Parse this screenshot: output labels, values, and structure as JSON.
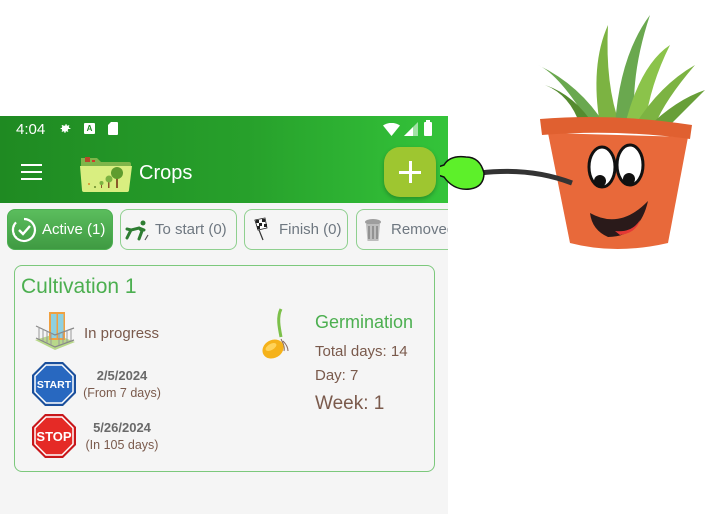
{
  "statusbar": {
    "time": "4:04",
    "icons": [
      "gear-icon",
      "a-notification-icon",
      "sd-card-icon",
      "wifi-icon",
      "signal-icon",
      "battery-icon"
    ]
  },
  "appbar": {
    "title": "Crops",
    "menu_icon": "hamburger-menu-icon",
    "logo_icon": "crops-folder-icon",
    "fab_icon": "plus-icon"
  },
  "colors": {
    "appbar_start": "#1f8a22",
    "appbar_end": "#34c43a",
    "fab": "#9ec630",
    "accent_green": "#4caf50",
    "text_brown": "#7a5a4c",
    "chip_border": "#8fd08f"
  },
  "filters": [
    {
      "label": "Active (1)",
      "icon": "check-circle-icon",
      "active": true
    },
    {
      "label": "To start (0)",
      "icon": "runner-start-icon",
      "active": false
    },
    {
      "label": "Finish (0)",
      "icon": "checkered-flag-icon",
      "active": false
    },
    {
      "label": "Removed",
      "icon": "trash-can-icon",
      "active": false
    }
  ],
  "cultivations": [
    {
      "title": "Cultivation 1",
      "status": "In progress",
      "status_icon": "balcony-icon",
      "start": {
        "sign": "START",
        "date": "2/5/2024",
        "relative": "(From 7 days)"
      },
      "stop": {
        "sign": "STOP",
        "date": "5/26/2024",
        "relative": "(In 105 days)"
      },
      "stage": {
        "icon": "sprouting-seed-icon",
        "name": "Germination",
        "total_days": "Total days: 14",
        "day": "Day: 7",
        "week": "Week: 1"
      }
    }
  ],
  "mascot": {
    "icon": "pointing-plant-pot-mascot"
  }
}
